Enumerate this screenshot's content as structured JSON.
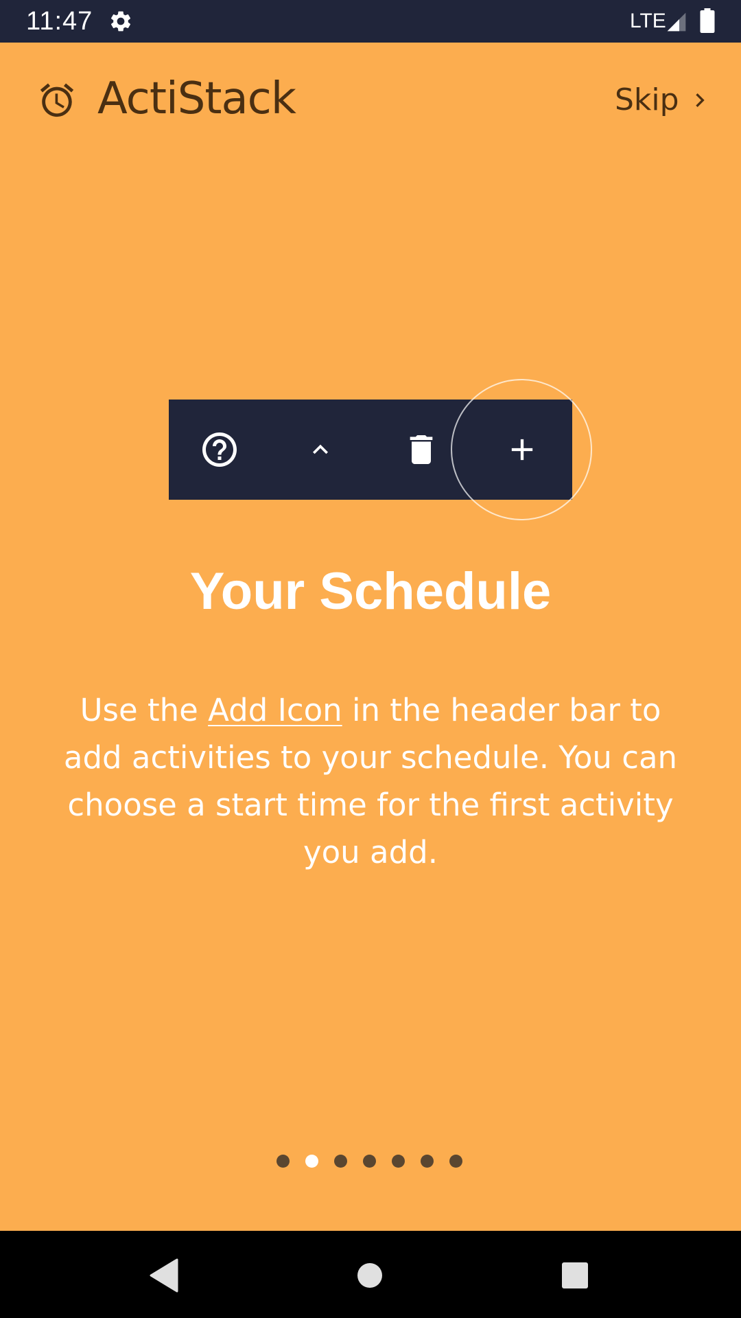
{
  "status_bar": {
    "time": "11:47",
    "network": "LTE",
    "icons": [
      "gear-icon",
      "signal-icon",
      "battery-icon"
    ]
  },
  "header": {
    "app_name": "ActiStack",
    "logo_icon": "alarm-clock-icon",
    "skip_label": "Skip"
  },
  "toolbar": {
    "buttons": [
      {
        "icon": "help-circle-icon"
      },
      {
        "icon": "chevron-up-icon"
      },
      {
        "icon": "trash-icon"
      },
      {
        "icon": "plus-icon",
        "highlighted": true
      }
    ]
  },
  "slide": {
    "title": "Your Schedule",
    "body_before": "Use the ",
    "body_link": "Add Icon",
    "body_after": " in the header bar to add activities to your schedule. You can choose a start time for the first activity you add."
  },
  "pager": {
    "total": 7,
    "active_index": 1
  },
  "colors": {
    "background": "#FCAD4F",
    "toolbar": "#20253A",
    "text_dark": "#4A2F12",
    "text_light": "#FFFFFF"
  }
}
